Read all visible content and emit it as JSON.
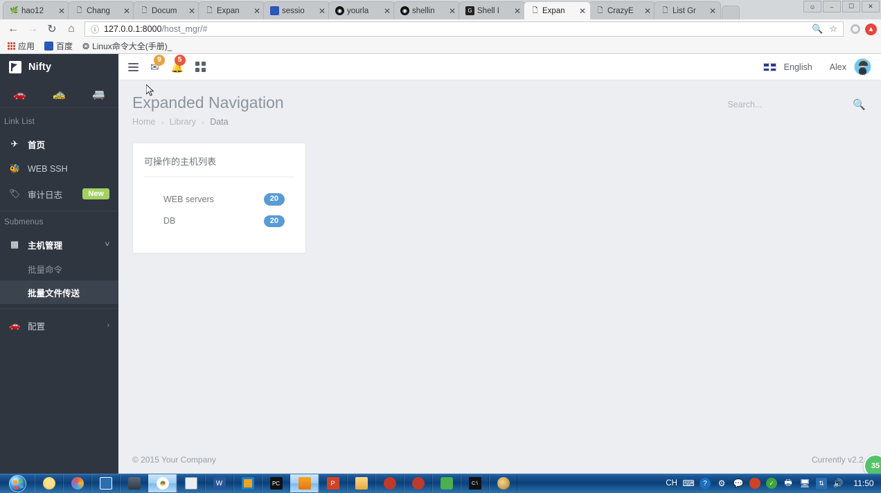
{
  "browser": {
    "tabs": [
      {
        "label": "hao12",
        "favicon": "hao123-icon",
        "active": false
      },
      {
        "label": "Chang",
        "favicon": "document-icon",
        "active": false
      },
      {
        "label": "Docum",
        "favicon": "document-icon",
        "active": false
      },
      {
        "label": "Expan",
        "favicon": "document-icon",
        "active": false
      },
      {
        "label": "sessio",
        "favicon": "baidu-icon",
        "active": false
      },
      {
        "label": "yourla",
        "favicon": "github-icon",
        "active": false
      },
      {
        "label": "shellin",
        "favicon": "github-icon",
        "active": false
      },
      {
        "label": "Shell I",
        "favicon": "gitbook-icon",
        "active": false
      },
      {
        "label": "Expan",
        "favicon": "document-icon",
        "active": true
      },
      {
        "label": "CrazyE",
        "favicon": "document-icon",
        "active": false
      },
      {
        "label": "List Gr",
        "favicon": "document-icon",
        "active": false
      }
    ],
    "tab_close_glyph": "✕",
    "window_buttons": [
      "minimize-icon",
      "maximize-icon",
      "close-icon"
    ],
    "nav": {
      "back_icon": "back-arrow-icon",
      "forward_icon": "forward-arrow-icon",
      "reload_icon": "reload-icon",
      "home_icon": "home-icon",
      "info_icon": "page-info-icon",
      "url_host": "127.0.0.1:8000",
      "url_path": "/host_mgr/#",
      "zoom_icon": "zoom-out-icon",
      "bookmark_icon": "star-icon",
      "extension_gray_icon": "gray-circle-extension-icon",
      "extension_red_icon": "red-circle-extension-icon"
    },
    "bookmarks": [
      {
        "label": "应用",
        "icon": "apps-grid-icon"
      },
      {
        "label": "百度",
        "icon": "baidu-icon"
      },
      {
        "label": "Linux命令大全(手册)_",
        "icon": "link-icon"
      }
    ]
  },
  "sidebar": {
    "brand": "Nifty",
    "brand_logo_icon": "nifty-flag-logo-icon",
    "quick_icons": [
      "car-icon",
      "taxi-icon",
      "bus-icon"
    ],
    "link_list_label": "Link List",
    "items": [
      {
        "label": "首页",
        "icon": "plane-icon",
        "active": true,
        "badge": null
      },
      {
        "label": "WEB SSH",
        "icon": "bug-icon",
        "active": false,
        "badge": null
      },
      {
        "label": "审计日志",
        "icon": "tag-icon",
        "active": false,
        "badge": "New"
      }
    ],
    "submenus_label": "Submenus",
    "groups": [
      {
        "label": "主机管理",
        "icon": "grid-icon",
        "chevron": "chevron-down-icon",
        "expanded": true,
        "children": [
          {
            "label": "批量命令",
            "selected": false
          },
          {
            "label": "批量文件传送",
            "selected": true
          }
        ]
      },
      {
        "label": "配置",
        "icon": "car-icon",
        "chevron": "chevron-right-icon",
        "expanded": false,
        "children": []
      }
    ]
  },
  "topnav": {
    "menu_toggle_icon": "hamburger-icon",
    "messages_icon": "envelope-icon",
    "messages_count": "9",
    "alerts_icon": "bell-icon",
    "alerts_count": "5",
    "apps_icon": "grid-apps-icon",
    "language_flag_icon": "uk-flag-icon",
    "language": "English",
    "user_name": "Alex",
    "avatar_icon": "user-avatar"
  },
  "page": {
    "title": "Expanded Navigation",
    "breadcrumb": [
      "Home",
      "Library",
      "Data"
    ],
    "breadcrumb_sep": "›",
    "search": {
      "placeholder": "Search...",
      "value": "",
      "icon": "search-icon"
    },
    "card": {
      "title": "可操作的主机列表",
      "rows": [
        {
          "label": "WEB servers",
          "count": "20"
        },
        {
          "label": "DB",
          "count": "20"
        }
      ]
    },
    "cursor_icon": "mouse-pointer-icon"
  },
  "footer": {
    "copyright": "© 2015 Your Company",
    "version": "Currently v2.2.",
    "float_badge": "35"
  },
  "taskbar": {
    "start_icon": "windows-start-orb",
    "items": [
      {
        "icon": "thunder-app-icon",
        "active": false
      },
      {
        "icon": "paint-app-icon",
        "active": false
      },
      {
        "icon": "save-app-icon",
        "active": false
      },
      {
        "icon": "key-app-icon",
        "active": false
      },
      {
        "icon": "chrome-icon",
        "active": true
      },
      {
        "icon": "notepad-app-icon",
        "active": false
      },
      {
        "icon": "word-icon",
        "active": false
      },
      {
        "icon": "framed-app-icon",
        "active": false
      },
      {
        "icon": "pycharm-icon",
        "active": false
      },
      {
        "icon": "orange-app-icon",
        "active": true
      },
      {
        "icon": "powerpoint-icon",
        "active": false
      },
      {
        "icon": "explorer-folder-icon",
        "active": false
      },
      {
        "icon": "red-app-icon",
        "active": false
      },
      {
        "icon": "red-app-icon-2",
        "active": false
      },
      {
        "icon": "green-shield-icon",
        "active": false
      },
      {
        "icon": "cmd-console-icon",
        "active": false
      },
      {
        "icon": "paint-brush-icon",
        "active": false
      }
    ],
    "tray": {
      "ime_label": "CH",
      "keyboard_icon": "keyboard-icon",
      "help_icon": "help-icon",
      "ime_options_icon": "ime-options-icon",
      "balloon_icon": "balloon-icon",
      "record_icon": "record-icon",
      "shield_icon": "shield-icon",
      "share_icon": "share-icon",
      "network_icon": "network-icon",
      "update_icon": "update-icon",
      "volume_icon": "volume-icon",
      "clock": "11:50"
    }
  },
  "colors": {
    "sidebar_bg": "#2f3640",
    "accent_pill": "#5b9bd5",
    "badge_new": "#a2d161",
    "badge_warn": "#e8a33d",
    "badge_danger": "#e9573f",
    "float_badge": "#53c36a"
  }
}
